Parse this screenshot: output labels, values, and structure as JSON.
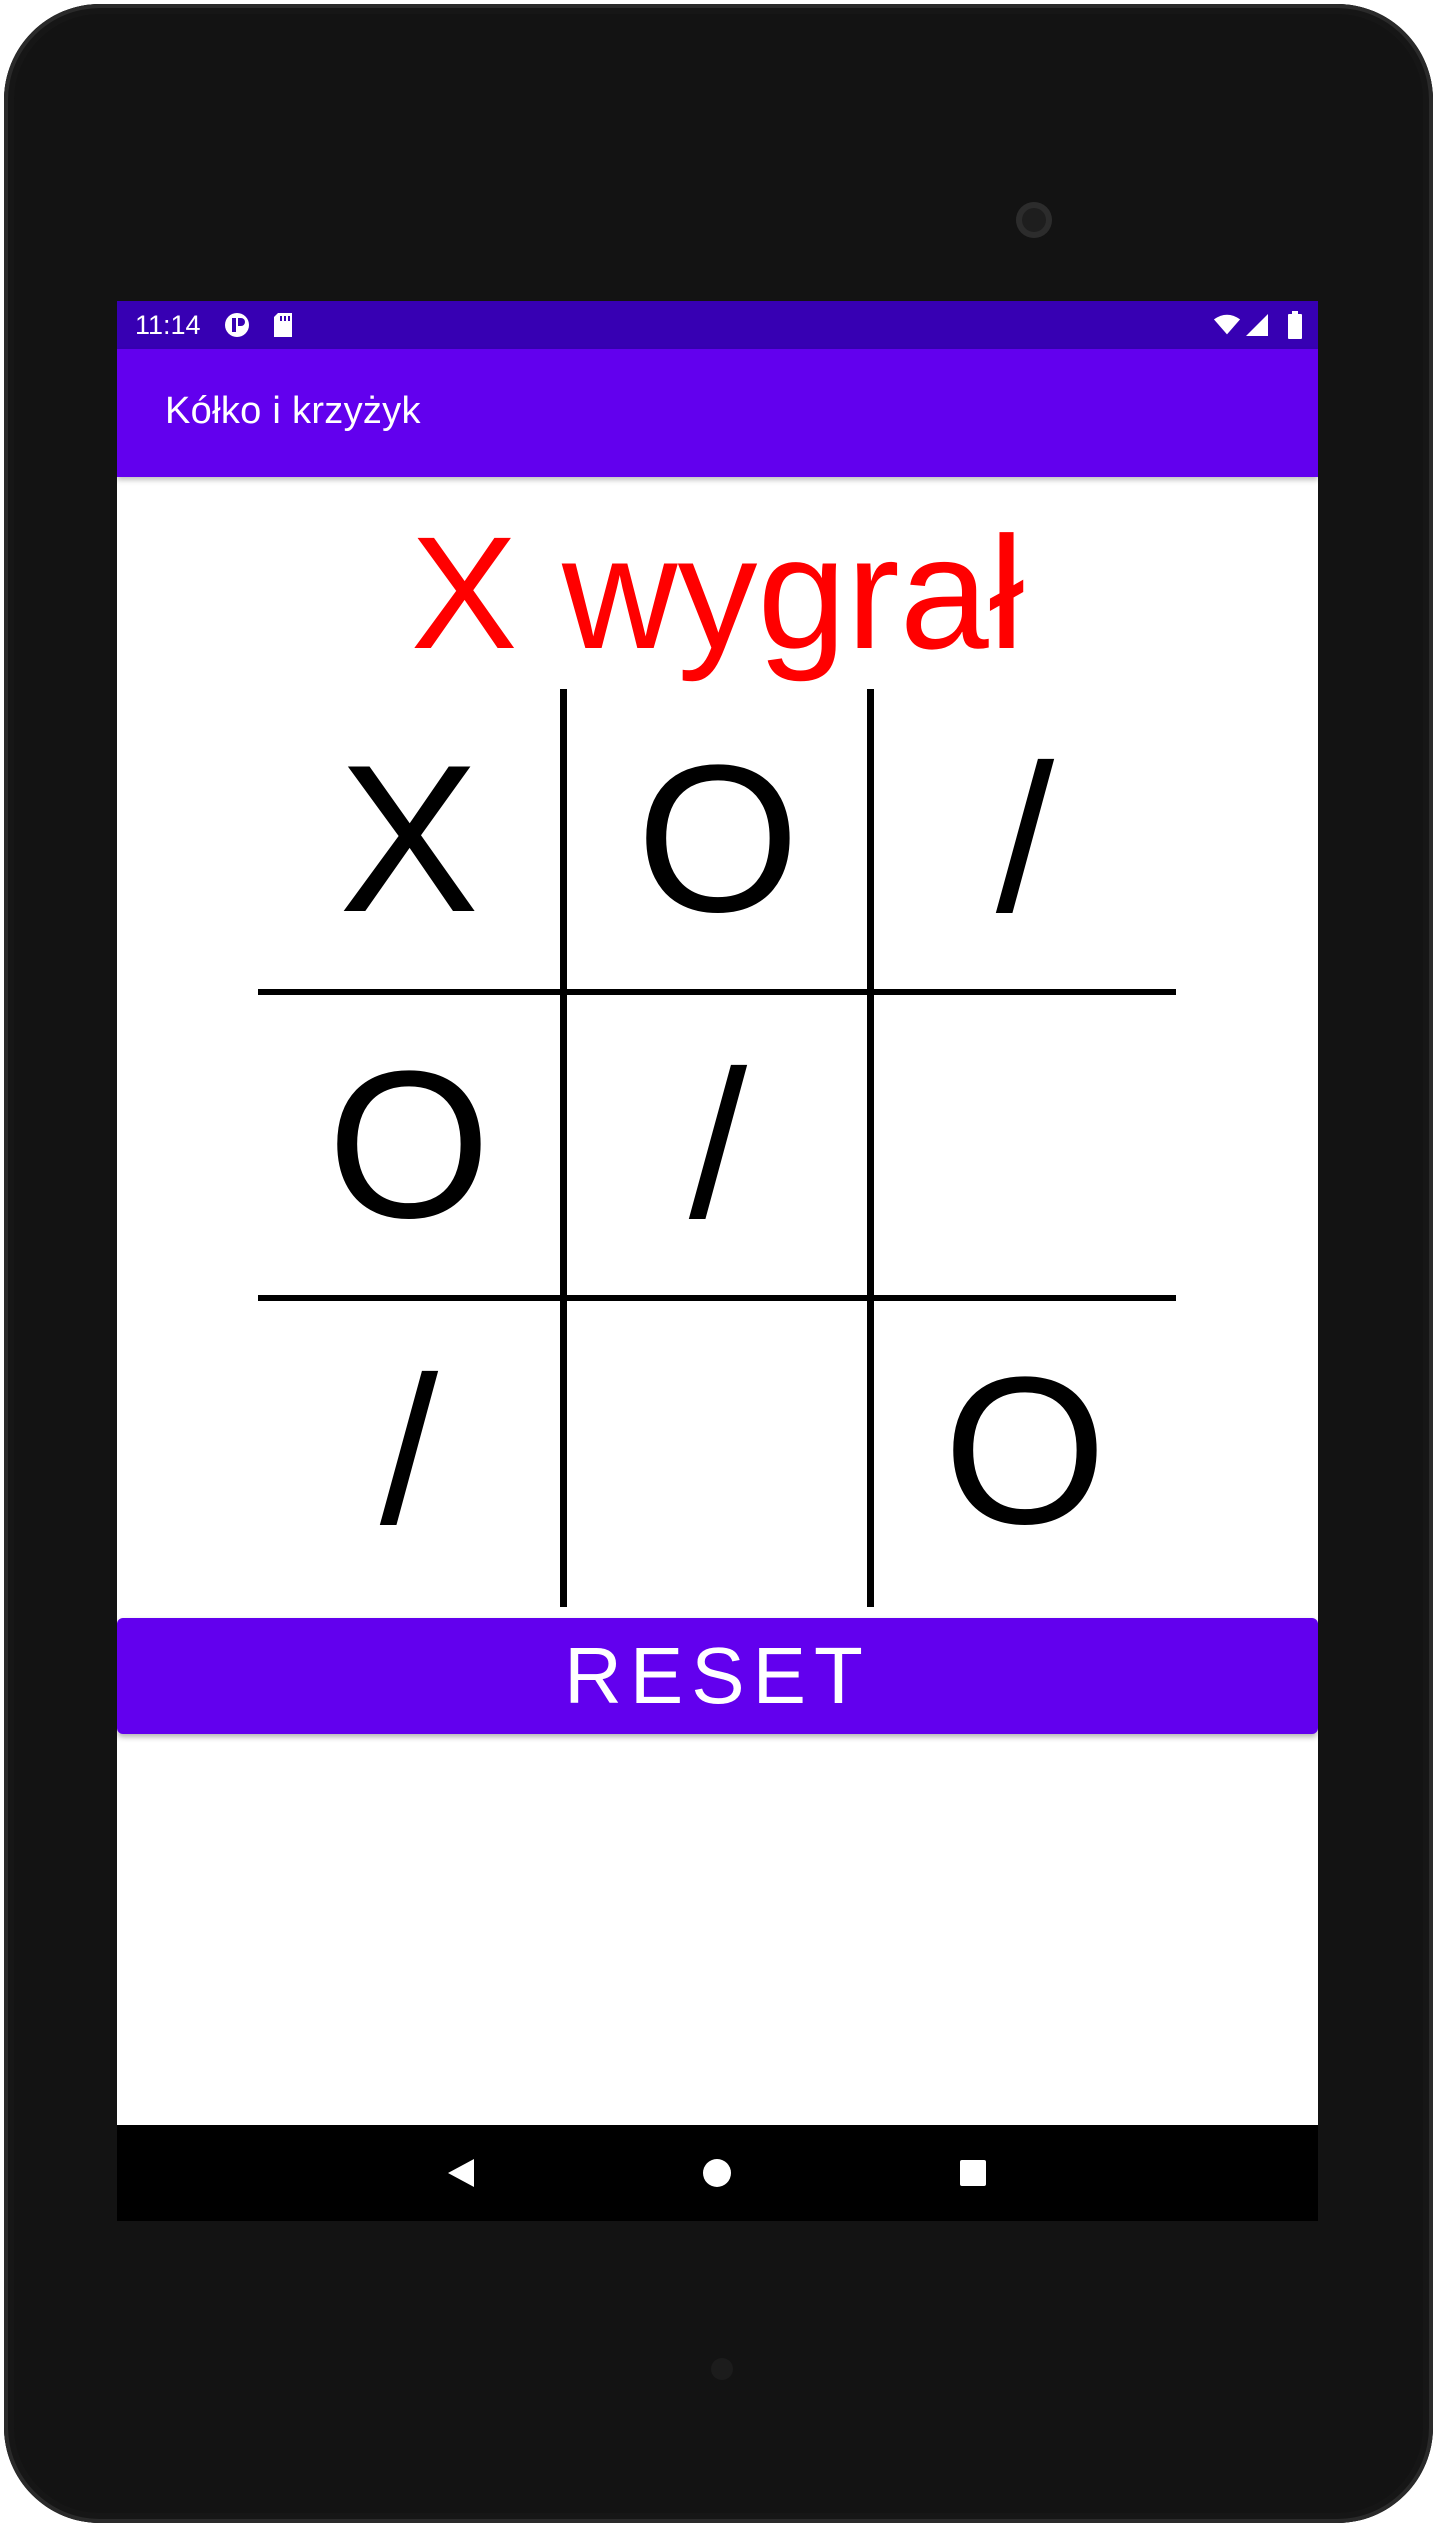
{
  "status_bar": {
    "time": "11:14",
    "left_icons": [
      "sync-notification-icon",
      "sd-card-icon"
    ],
    "right_icons": [
      "wifi-icon",
      "cell-signal-icon",
      "battery-icon"
    ]
  },
  "app_bar": {
    "title": "Kółko i krzyżyk"
  },
  "game": {
    "status_text": "X wygrał",
    "status_color": "#ff0000",
    "board": [
      [
        "X",
        "O",
        "/"
      ],
      [
        "O",
        "/",
        ""
      ],
      [
        "/",
        "",
        "O"
      ]
    ]
  },
  "reset_button": {
    "label": "RESET"
  },
  "nav_bar": {
    "buttons": [
      "back-icon",
      "home-icon",
      "recents-icon"
    ]
  },
  "colors": {
    "status_bar": "#3700b3",
    "primary": "#6200ee",
    "board_lines": "#000000",
    "device_frame": "#131313"
  }
}
